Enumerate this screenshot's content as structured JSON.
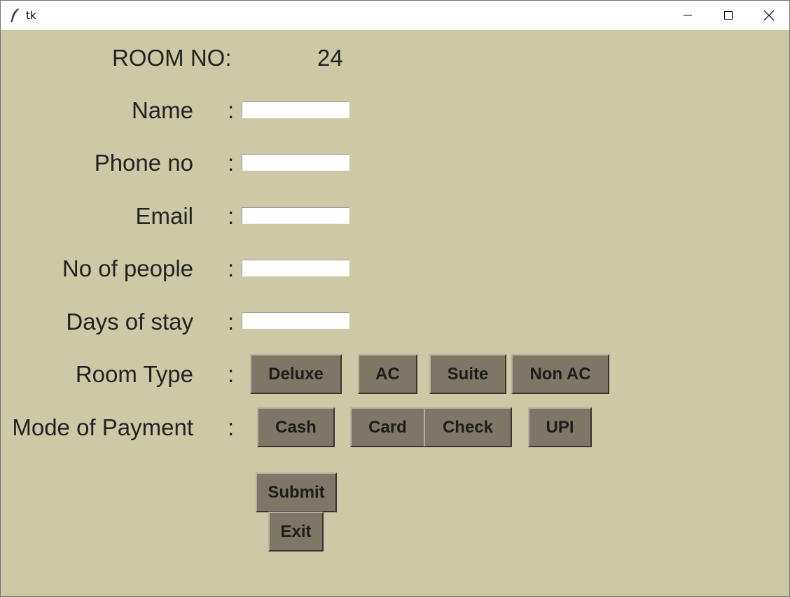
{
  "window": {
    "title": "tk",
    "controls": {
      "minimize": "minimize-icon",
      "maximize": "maximize-icon",
      "close": "close-icon"
    }
  },
  "form": {
    "room_no_label": "ROOM NO:",
    "room_no_value": "24",
    "colon": ":",
    "fields": {
      "name": {
        "label": "Name",
        "value": ""
      },
      "phone": {
        "label": "Phone no",
        "value": ""
      },
      "email": {
        "label": "Email",
        "value": ""
      },
      "people": {
        "label": "No of people",
        "value": ""
      },
      "days": {
        "label": "Days of stay",
        "value": ""
      }
    },
    "room_type": {
      "label": "Room Type",
      "options": [
        "Deluxe",
        "AC",
        "Suite",
        "Non AC"
      ]
    },
    "payment": {
      "label": "Mode of Payment",
      "options": [
        "Cash",
        "Card",
        "Check",
        "UPI"
      ]
    },
    "submit_label": "Submit",
    "exit_label": "Exit"
  },
  "colors": {
    "background": "#cdc9a6",
    "button": "#7e7766",
    "entry": "#ffffff"
  }
}
